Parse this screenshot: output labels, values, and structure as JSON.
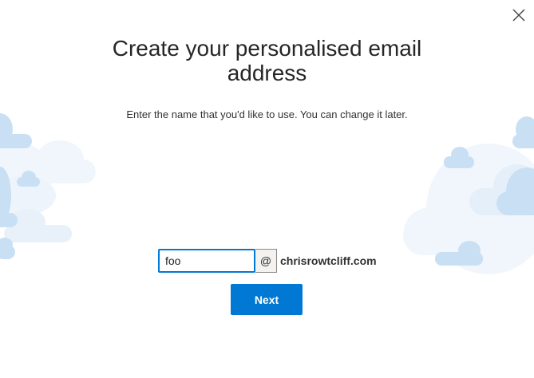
{
  "dialog": {
    "title": "Create your personalised email address",
    "subtitle": "Enter the name that you'd like to use. You can change it later.",
    "close_icon": "close-icon"
  },
  "email": {
    "name_value": "foo",
    "at_symbol": "@",
    "domain": "chrisrowtcliff.com"
  },
  "actions": {
    "next_label": "Next"
  },
  "colors": {
    "accent": "#0078d4",
    "cloud_light": "#eaf3fb",
    "cloud_mid": "#d6e8f7",
    "cloud_dark": "#bcd9f1"
  }
}
